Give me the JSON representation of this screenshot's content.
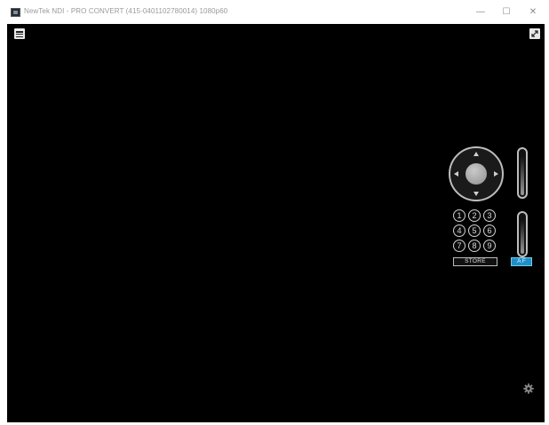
{
  "window": {
    "title": "NewTek NDI - PRO CONVERT (415-0401102780014) 1080p60",
    "minimize_glyph": "—",
    "maximize_glyph": "☐",
    "close_glyph": "✕"
  },
  "viewer": {
    "menu_icon": "hamburger-menu-icon",
    "fullscreen_icon": "expand-icon",
    "settings_icon": "gear-icon"
  },
  "ptz": {
    "presets": [
      "1",
      "2",
      "3",
      "4",
      "5",
      "6",
      "7",
      "8",
      "9"
    ],
    "store_label": "STORE",
    "af_label": "A F"
  },
  "colors": {
    "viewport_bg": "#000000",
    "accent": "#1d8fc8"
  }
}
